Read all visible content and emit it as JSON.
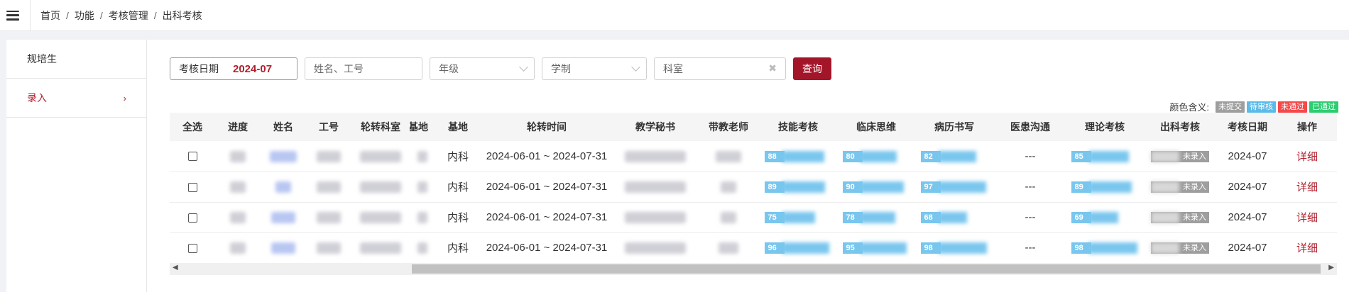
{
  "breadcrumb": [
    "首页",
    "功能",
    "考核管理",
    "出科考核"
  ],
  "sidebar": {
    "items": [
      {
        "label": "规培生"
      },
      {
        "label": "录入",
        "chevron": "›"
      }
    ]
  },
  "filters": {
    "date_label": "考核日期",
    "date_value": "2024-07",
    "name_placeholder": "姓名、工号",
    "grade_placeholder": "年级",
    "system_placeholder": "学制",
    "dept_value": "科室",
    "clear_glyph": "✖",
    "query_label": "查询"
  },
  "legend": {
    "label": "颜色含义:",
    "items": [
      {
        "label": "未提交",
        "color": "#9e9e9e"
      },
      {
        "label": "待审核",
        "color": "#5bbbe8"
      },
      {
        "label": "未通过",
        "color": "#f5494a"
      },
      {
        "label": "已通过",
        "color": "#2ecc71"
      }
    ]
  },
  "table": {
    "columns": [
      "全选",
      "进度",
      "姓名",
      "工号",
      "轮转科室",
      "基地",
      "基地",
      "轮转时间",
      "教学秘书",
      "带教老师",
      "技能考核",
      "临床思维",
      "病历书写",
      "医患沟通",
      "理论考核",
      "出科考核",
      "考核日期",
      "操作"
    ],
    "rows": [
      {
        "base": "内科",
        "period": "2024-06-01 ~ 2024-07-31",
        "skill": "88",
        "skill_pct": 0.88,
        "clinical": "80",
        "clinical_pct": 0.8,
        "record": "82",
        "record_pct": 0.82,
        "comm": "---",
        "theory": "85",
        "theory_pct": 0.85,
        "exit": "未录入",
        "date": "2024-07",
        "action": "详细"
      },
      {
        "base": "内科",
        "period": "2024-06-01 ~ 2024-07-31",
        "skill": "89",
        "skill_pct": 0.89,
        "clinical": "90",
        "clinical_pct": 0.9,
        "record": "97",
        "record_pct": 0.97,
        "comm": "---",
        "theory": "89",
        "theory_pct": 0.89,
        "exit": "未录入",
        "date": "2024-07",
        "action": "详细"
      },
      {
        "base": "内科",
        "period": "2024-06-01 ~ 2024-07-31",
        "skill": "75",
        "skill_pct": 0.75,
        "clinical": "78",
        "clinical_pct": 0.78,
        "record": "68",
        "record_pct": 0.68,
        "comm": "---",
        "theory": "69",
        "theory_pct": 0.69,
        "exit": "未录入",
        "date": "2024-07",
        "action": "详细"
      },
      {
        "base": "内科",
        "period": "2024-06-01 ~ 2024-07-31",
        "skill": "96",
        "skill_pct": 0.96,
        "clinical": "95",
        "clinical_pct": 0.95,
        "record": "98",
        "record_pct": 0.98,
        "comm": "---",
        "theory": "98",
        "theory_pct": 0.98,
        "exit": "未录入",
        "date": "2024-07",
        "action": "详细"
      }
    ]
  },
  "scrollbar": {
    "left": "◀",
    "right": "▶"
  }
}
